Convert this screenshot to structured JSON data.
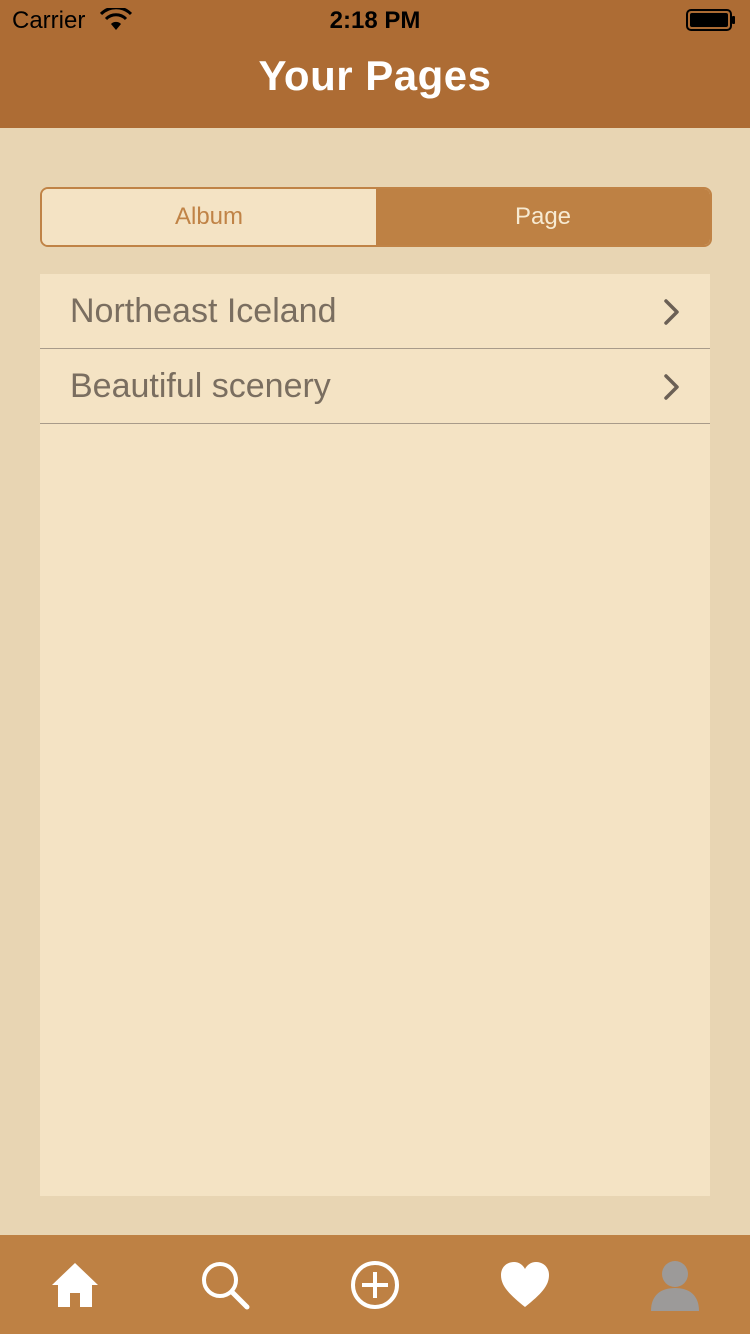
{
  "status_bar": {
    "carrier": "Carrier",
    "time": "2:18 PM"
  },
  "header": {
    "title": "Your Pages"
  },
  "segmented": {
    "options": [
      "Album",
      "Page"
    ],
    "selected": "Page"
  },
  "list": {
    "items": [
      {
        "label": "Northeast Iceland"
      },
      {
        "label": "Beautiful scenery"
      }
    ]
  },
  "tab_bar": {
    "tabs": [
      {
        "icon": "home-icon"
      },
      {
        "icon": "search-icon"
      },
      {
        "icon": "add-circle-icon"
      },
      {
        "icon": "heart-icon"
      },
      {
        "icon": "profile-icon"
      }
    ]
  },
  "colors": {
    "header": "#ad6c34",
    "background": "#e8d5b3",
    "panel": "#f4e3c4",
    "accent": "#be8144"
  }
}
